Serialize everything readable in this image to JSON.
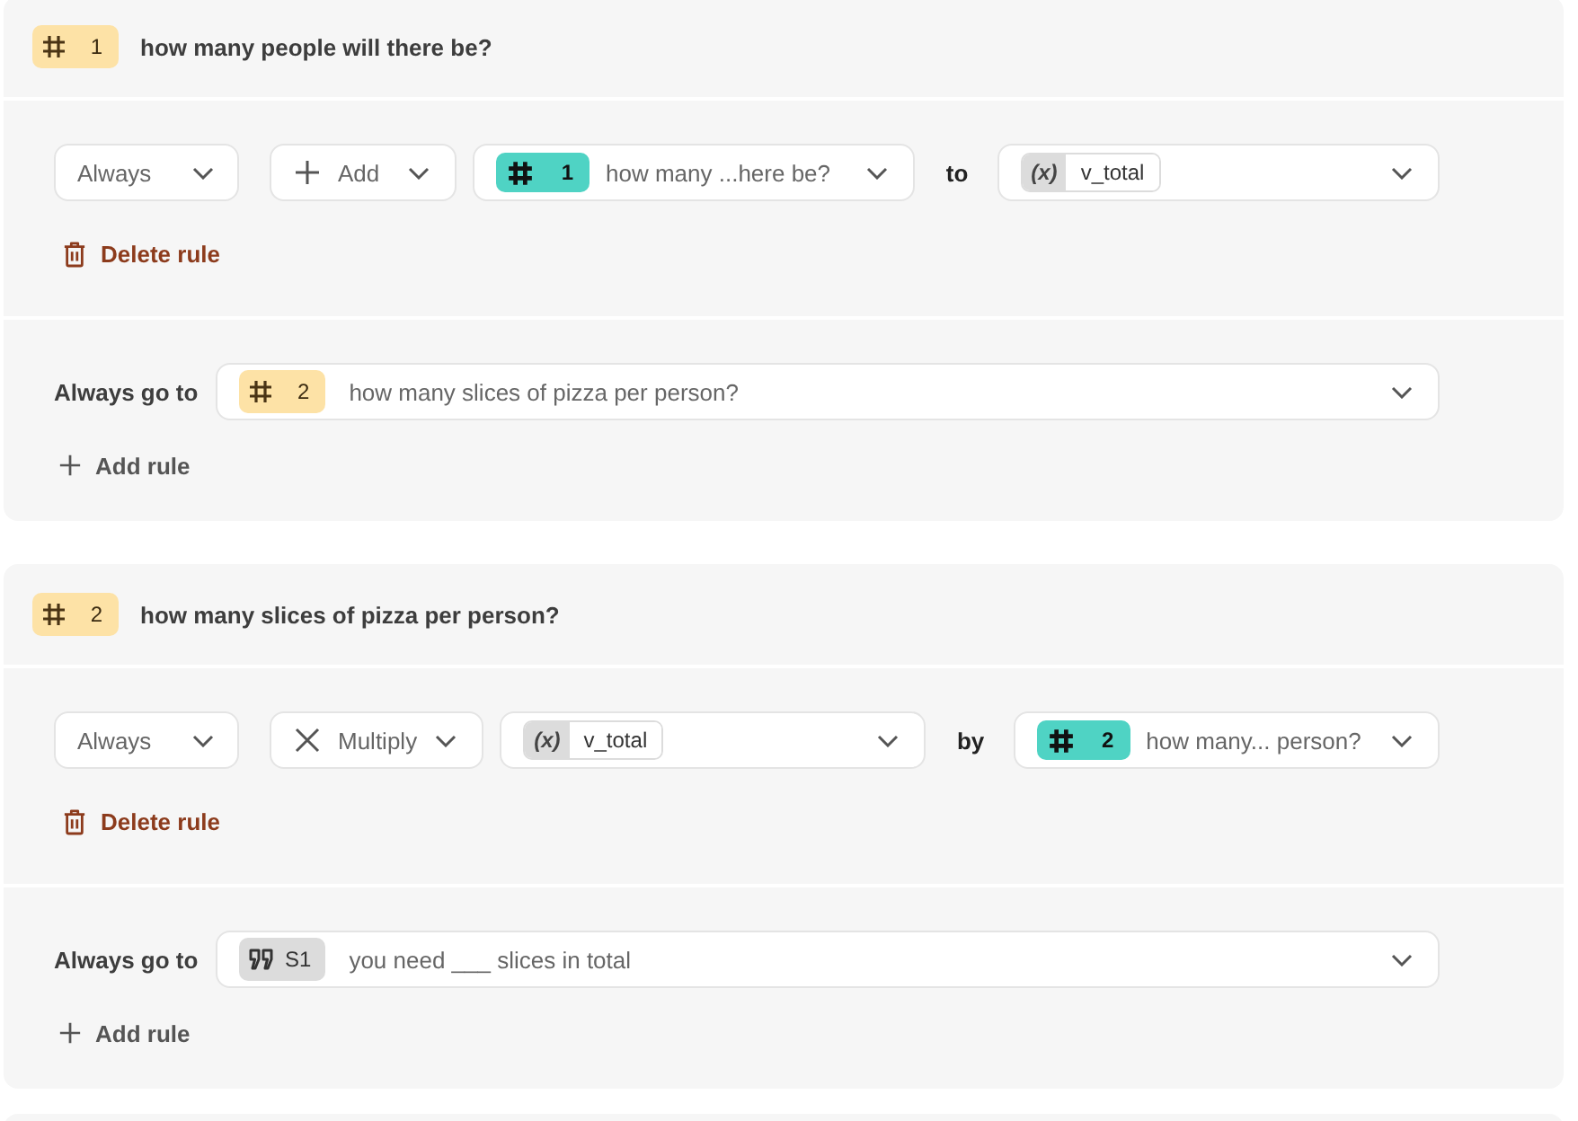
{
  "cards": [
    {
      "badge": {
        "kind": "question",
        "number": "1"
      },
      "title": "how many people will there be?",
      "rule": {
        "condition": "Always",
        "operation": {
          "kind": "add",
          "label": "Add"
        },
        "operand": {
          "kind": "question",
          "number": "1",
          "text": "how many ...here be?"
        },
        "connector": "to",
        "target": {
          "kind": "variable",
          "symbol": "(x)",
          "name": "v_total"
        },
        "delete_label": "Delete rule"
      },
      "goto": {
        "label": "Always go to",
        "destination": {
          "kind": "question",
          "number": "2",
          "text": "how many slices of pizza per person?"
        },
        "add_rule_label": "Add rule"
      }
    },
    {
      "badge": {
        "kind": "question",
        "number": "2"
      },
      "title": "how many slices of pizza per person?",
      "rule": {
        "condition": "Always",
        "operation": {
          "kind": "multiply",
          "label": "Multiply"
        },
        "operand": {
          "kind": "variable",
          "symbol": "(x)",
          "name": "v_total"
        },
        "connector": "by",
        "target": {
          "kind": "question",
          "number": "2",
          "text": "how many... person?"
        },
        "delete_label": "Delete rule"
      },
      "goto": {
        "label": "Always go to",
        "destination": {
          "kind": "statement",
          "number": "S1",
          "text": "you need ___ slices in total"
        },
        "add_rule_label": "Add rule"
      }
    }
  ]
}
